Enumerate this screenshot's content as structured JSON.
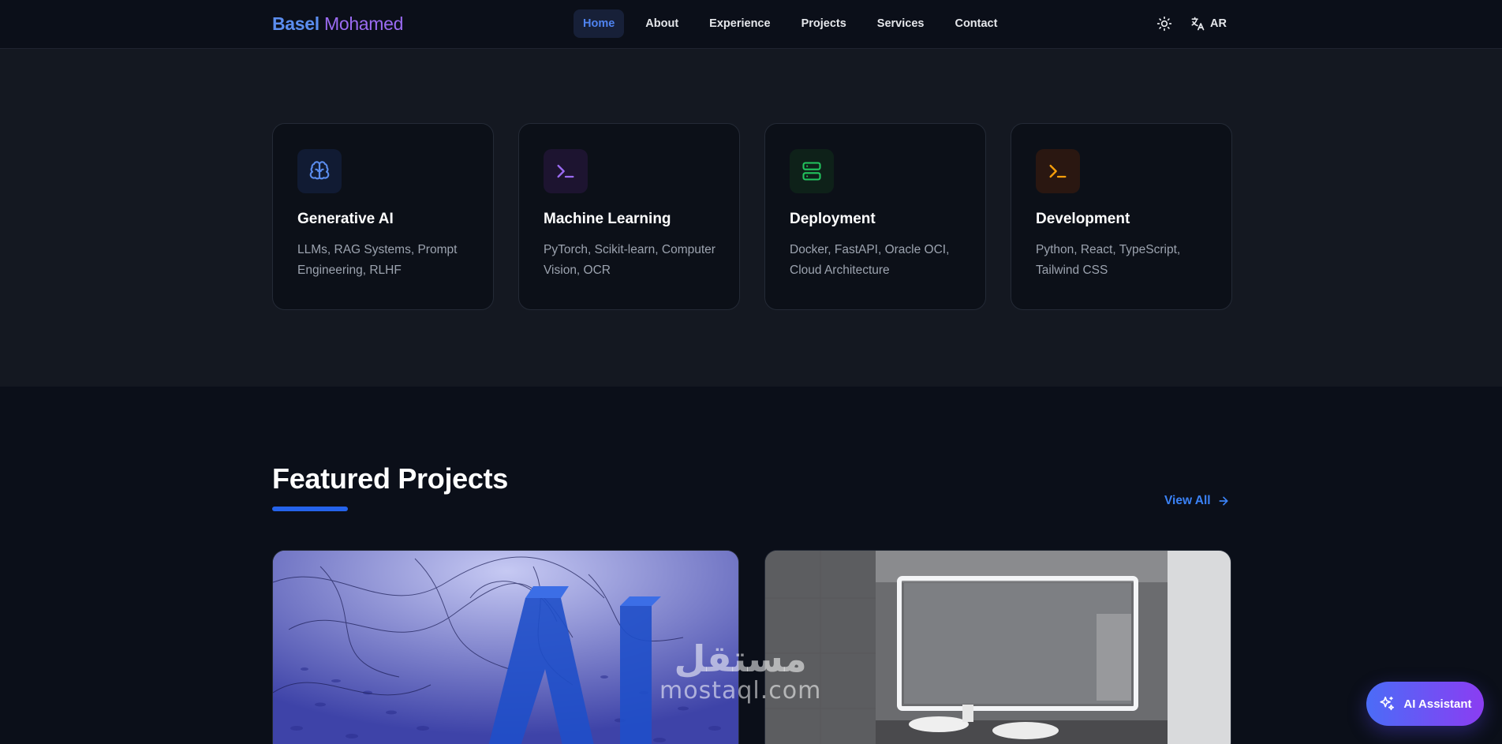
{
  "header": {
    "logo_first": "Basel",
    "logo_last": "Mohamed",
    "nav": [
      {
        "label": "Home",
        "active": true
      },
      {
        "label": "About",
        "active": false
      },
      {
        "label": "Experience",
        "active": false
      },
      {
        "label": "Projects",
        "active": false
      },
      {
        "label": "Services",
        "active": false
      },
      {
        "label": "Contact",
        "active": false
      }
    ],
    "theme_icon": "sun-icon",
    "language_label": "AR",
    "language_icon": "translate-icon"
  },
  "skills": [
    {
      "title": "Generative AI",
      "description": "LLMs, RAG Systems, Prompt Engineering, RLHF",
      "icon": "brain-icon",
      "color": "#5b8def"
    },
    {
      "title": "Machine Learning",
      "description": "PyTorch, Scikit-learn, Computer Vision, OCR",
      "icon": "terminal-icon",
      "color": "#9b6bf2"
    },
    {
      "title": "Deployment",
      "description": "Docker, FastAPI, Oracle OCI, Cloud Architecture",
      "icon": "server-icon",
      "color": "#22c55e"
    },
    {
      "title": "Development",
      "description": "Python, React, TypeScript, Tailwind CSS",
      "icon": "terminal-icon",
      "color": "#f59e0b"
    }
  ],
  "featured": {
    "title": "Featured Projects",
    "view_all": "View All"
  },
  "watermark": {
    "arabic": "مستقل",
    "latin": "mostaql.com"
  },
  "assistant": {
    "label": "AI Assistant",
    "icon": "sparkles-icon"
  },
  "colors": {
    "background": "#0b0f19",
    "section_background": "#141821",
    "accent_blue": "#2563eb",
    "accent_purple": "#8b3df2"
  }
}
